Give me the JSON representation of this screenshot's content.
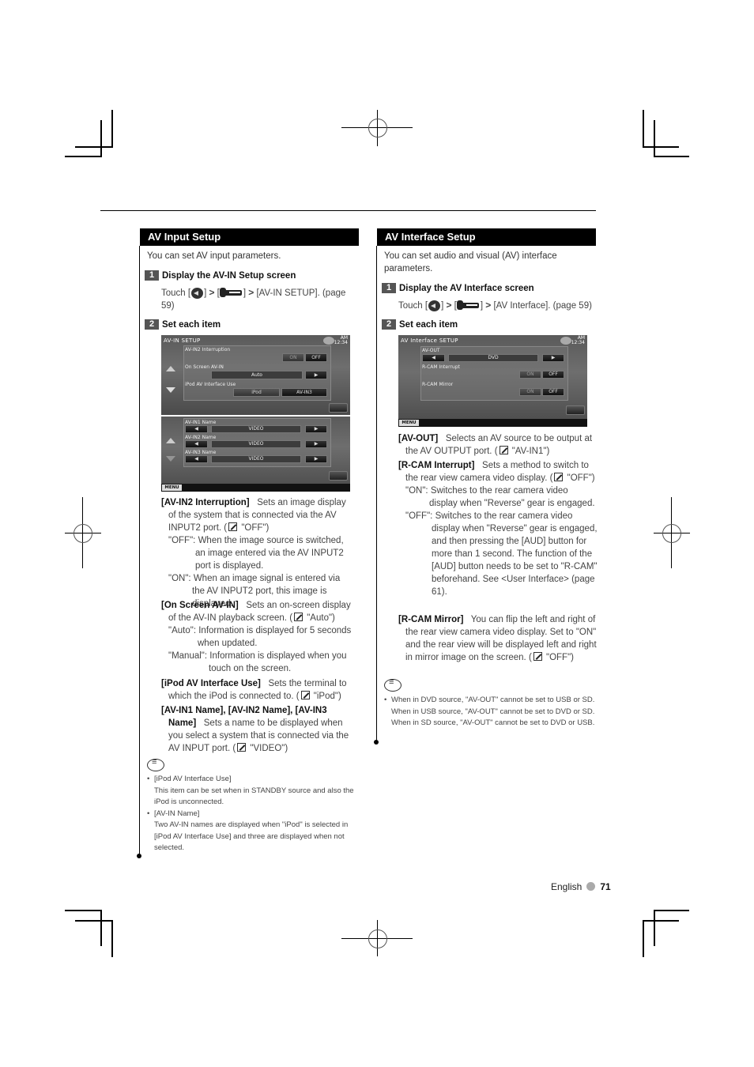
{
  "left": {
    "header": "AV Input Setup",
    "intro": "You can set AV input parameters.",
    "step1": {
      "num": "1",
      "title": "Display the AV-IN Setup screen",
      "touch_prefix": "Touch [",
      "sep1": "] ",
      "sep2": " [",
      "sep3": "] ",
      "touch_suffix": " [AV-IN SETUP]. (page 59)"
    },
    "step2": {
      "num": "2",
      "title": "Set each item"
    },
    "screen1": {
      "title": "AV-IN SETUP",
      "clock_ampm": "AM",
      "clock_time": "12:34",
      "rows": [
        {
          "label": "AV-IN2 Interruption",
          "on": "ON",
          "off": "OFF"
        },
        {
          "label": "On Screen AV-IN",
          "value": "Auto"
        },
        {
          "label": "iPod AV Interface Use",
          "opt1": "iPod",
          "opt2": "AV-IN3"
        }
      ]
    },
    "screen2": {
      "rows": [
        {
          "label": "AV-IN1 Name",
          "value": "VIDEO"
        },
        {
          "label": "AV-IN2 Name",
          "value": "VIDEO"
        },
        {
          "label": "AV-IN3 Name",
          "value": "VIDEO"
        }
      ],
      "menu": "MENU"
    },
    "items": [
      {
        "term": "[AV-IN2 Interruption]",
        "desc": "Sets an image display of the system that is connected via the AV INPUT2 port. (",
        "default": " \"OFF\")",
        "options": [
          {
            "key": "\"OFF\":",
            "text": "When the image source is switched, an image entered via the AV INPUT2 port is displayed."
          },
          {
            "key": "\"ON\":",
            "text": "When an image signal is entered via the AV INPUT2 port, this image is displayed."
          }
        ]
      },
      {
        "term": "[On Screen AV-IN]",
        "desc": "Sets an on-screen display of the AV-IN playback screen. (",
        "default": " \"Auto\")",
        "options": [
          {
            "key": "\"Auto\":",
            "text": "Information is displayed for 5 seconds when updated."
          },
          {
            "key": "\"Manual\":",
            "text": "Information is displayed when you touch on the screen."
          }
        ]
      },
      {
        "term": "[iPod AV Interface Use]",
        "desc": "Sets the terminal to which the iPod is connected to. (",
        "default": " \"iPod\")"
      },
      {
        "term": "[AV-IN1 Name], [AV-IN2 Name], [AV-IN3 Name]",
        "desc": "Sets a name to be displayed when you select a system that is connected via the AV INPUT port. (",
        "default": " \"VIDEO\")"
      }
    ],
    "notes": [
      {
        "title": "[iPod AV Interface Use]",
        "text": "This item can be set when in STANDBY source and also the iPod is unconnected."
      },
      {
        "title": "[AV-IN Name]",
        "text": "Two AV-IN names are displayed when \"iPod\" is selected in [iPod AV Interface Use] and three are displayed when not selected."
      }
    ]
  },
  "right": {
    "header": "AV Interface Setup",
    "intro": "You can set audio and visual (AV) interface parameters.",
    "step1": {
      "num": "1",
      "title": "Display the AV Interface screen",
      "touch_prefix": "Touch [",
      "sep1": "] ",
      "sep2": " [",
      "sep3": "] ",
      "touch_suffix": " [AV Interface]. (page 59)"
    },
    "step2": {
      "num": "2",
      "title": "Set each item"
    },
    "screen": {
      "title": "AV Interface SETUP",
      "clock_ampm": "AM",
      "clock_time": "12:34",
      "rows": [
        {
          "label": "AV-OUT",
          "value": "DVD"
        },
        {
          "label": "R-CAM Interrupt",
          "on": "ON",
          "off": "OFF"
        },
        {
          "label": "R-CAM Mirror",
          "on": "ON",
          "off": "OFF"
        }
      ],
      "menu": "MENU"
    },
    "items": [
      {
        "term": "[AV-OUT]",
        "desc": "Selects an AV source to be output at the AV OUTPUT port. (",
        "default": " \"AV-IN1\")"
      },
      {
        "term": "[R-CAM Interrupt]",
        "desc": "Sets a method to switch to the rear view camera video display. (",
        "default": " \"OFF\")",
        "options": [
          {
            "key": "\"ON\":",
            "text": "Switches to the rear camera video display when \"Reverse\" gear is engaged."
          },
          {
            "key": "\"OFF\":",
            "text": "Switches to the rear camera video display when \"Reverse\" gear is engaged, and then pressing the [AUD] button for more than 1 second. The function of the [AUD] button needs to be set to \"R-CAM\" beforehand.  See <User Interface> (page 61)."
          }
        ]
      },
      {
        "term": "[R-CAM Mirror]",
        "desc": "You can flip the left and right of the rear view camera video display. Set to \"ON\" and the rear view will be displayed left and right in mirror image on the screen. (",
        "default": " \"OFF\")"
      }
    ],
    "notes": [
      {
        "text": "When in DVD source, \"AV-OUT\" cannot be set to USB or SD. When in USB source, \"AV-OUT\" cannot be set to DVD or SD. When in SD source, \"AV-OUT\" cannot be set to DVD or USB."
      }
    ]
  },
  "footer": {
    "language": "English",
    "page": "71"
  }
}
